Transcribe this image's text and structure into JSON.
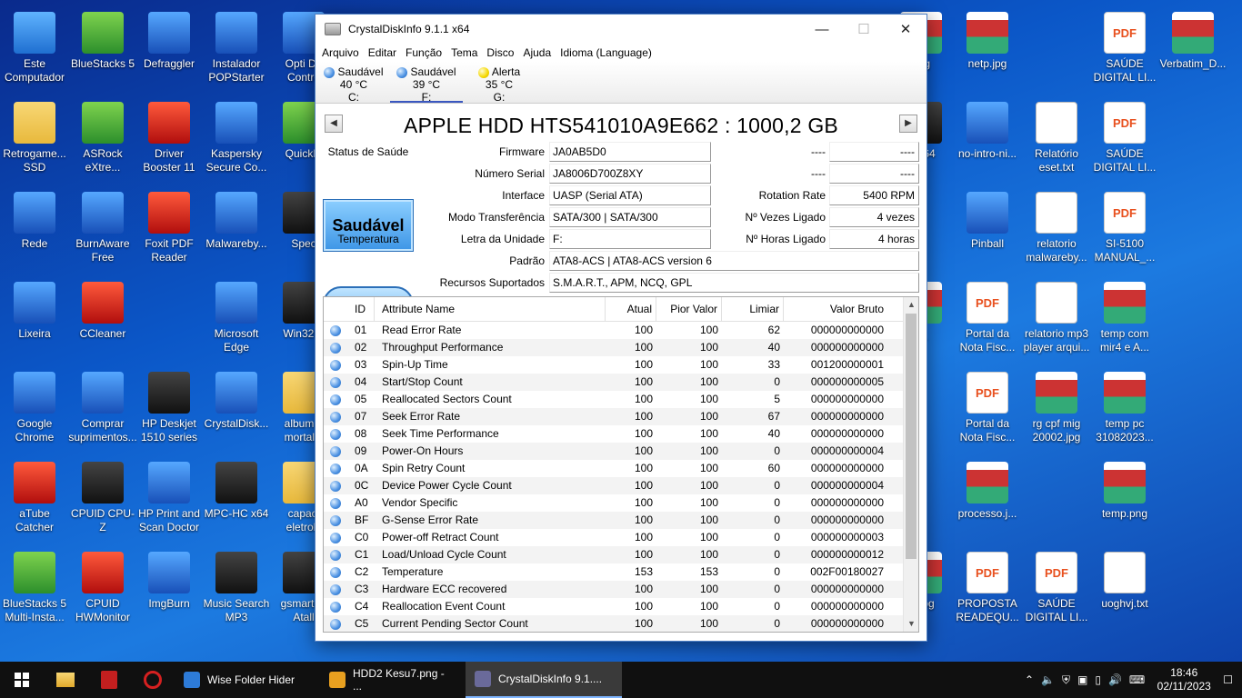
{
  "desktop_icons": [
    {
      "label": "Este Computador",
      "type": "pc"
    },
    {
      "label": "BlueStacks 5",
      "type": "green"
    },
    {
      "label": "Defraggler",
      "type": "blue"
    },
    {
      "label": "Instalador POPStarter",
      "type": "blue"
    },
    {
      "label": "Opti Dri Contro",
      "type": "blue"
    },
    {
      "label": "Retrogame... SSD",
      "type": "folder"
    },
    {
      "label": "ASRock eXtre...",
      "type": "green"
    },
    {
      "label": "Driver Booster 11",
      "type": "red"
    },
    {
      "label": "Kaspersky Secure Co...",
      "type": "blue"
    },
    {
      "label": "QuickM",
      "type": "green"
    },
    {
      "label": "Rede",
      "type": "blue"
    },
    {
      "label": "BurnAware Free",
      "type": "blue"
    },
    {
      "label": "Foxit PDF Reader",
      "type": "red"
    },
    {
      "label": "Malwareby...",
      "type": "blue"
    },
    {
      "label": "Spec",
      "type": "app"
    },
    {
      "label": "Lixeira",
      "type": "blue"
    },
    {
      "label": "CCleaner",
      "type": "red"
    },
    {
      "label": "Microsoft Edge",
      "type": "blue"
    },
    {
      "label": "Win32Di",
      "type": "app"
    },
    {
      "label": "Google Chrome",
      "type": "round"
    },
    {
      "label": "Comprar suprimentos...",
      "type": "blue"
    },
    {
      "label": "HP Deskjet 1510 series",
      "type": "app"
    },
    {
      "label": "CrystalDisk...",
      "type": "blue"
    },
    {
      "label": "album a mortal k",
      "type": "folder"
    },
    {
      "label": "aTube Catcher",
      "type": "red"
    },
    {
      "label": "CPUID CPU-Z",
      "type": "app"
    },
    {
      "label": "HP Print and Scan Doctor",
      "type": "blue"
    },
    {
      "label": "MPC-HC x64",
      "type": "app"
    },
    {
      "label": "capaci eletrolit",
      "type": "folder"
    },
    {
      "label": "BlueStacks 5 Multi-Insta...",
      "type": "green"
    },
    {
      "label": "CPUID HWMonitor",
      "type": "red"
    },
    {
      "label": "ImgBurn",
      "type": "round"
    },
    {
      "label": "Music Search MP3",
      "type": "app"
    },
    {
      "label": "gsmarto - Atall",
      "type": "app"
    },
    {
      "label": "peg",
      "type": "img"
    },
    {
      "label": "netp.jpg",
      "type": "img"
    },
    {
      "label": "SAÚDE DIGITAL LI...",
      "type": "pdf"
    },
    {
      "label": "Verbatim_D...",
      "type": "img"
    },
    {
      "label": "C x64",
      "type": "app"
    },
    {
      "label": "no-intro-ni...",
      "type": "blue"
    },
    {
      "label": "Relatório eset.txt",
      "type": "txt"
    },
    {
      "label": "SAÚDE DIGITAL LI...",
      "type": "pdf"
    },
    {
      "label": "Pinball",
      "type": "round"
    },
    {
      "label": "relatorio malwareby...",
      "type": "txt"
    },
    {
      "label": "SI-5100 MANUAL_...",
      "type": "pdf"
    },
    {
      "label": "h_",
      "type": "img"
    },
    {
      "label": "Portal da Nota Fisc...",
      "type": "pdf"
    },
    {
      "label": "relatorio mp3 player arqui...",
      "type": "txt"
    },
    {
      "label": "temp com mir4 e A...",
      "type": "img"
    },
    {
      "label": "Portal da Nota Fisc...",
      "type": "pdf"
    },
    {
      "label": "rg cpf mig 20002.jpg",
      "type": "img"
    },
    {
      "label": "temp pc 31082023...",
      "type": "img"
    },
    {
      "label": "processo.j...",
      "type": "img"
    },
    {
      "label": "temp.png",
      "type": "img"
    },
    {
      "label": "o .jpg",
      "type": "img"
    },
    {
      "label": "PROPOSTA READEQU...",
      "type": "pdf"
    },
    {
      "label": "SAÚDE DIGITAL LI...",
      "type": "pdf"
    },
    {
      "label": "uoghvj.txt",
      "type": "txt"
    }
  ],
  "window": {
    "title": "CrystalDiskInfo 9.1.1 x64",
    "menu": [
      "Arquivo",
      "Editar",
      "Função",
      "Tema",
      "Disco",
      "Ajuda",
      "Idioma (Language)"
    ],
    "drives": [
      {
        "status": "Saudável",
        "temp": "40 °C",
        "letter": "C:",
        "color": "blue"
      },
      {
        "status": "Saudável",
        "temp": "39 °C",
        "letter": "F:",
        "color": "blue"
      },
      {
        "status": "Alerta",
        "temp": "35 °C",
        "letter": "G:",
        "color": "yellow"
      }
    ],
    "model": "APPLE HDD HTS541010A9E662 : 1000,2 GB",
    "nav_prev": "◀",
    "nav_next": "▶",
    "health_label": "Status de Saúde",
    "health_value": "Saudável",
    "temp_label": "Temperatura",
    "temp_value": "39 °C",
    "fields": {
      "firmware_label": "Firmware",
      "firmware": "JA0AB5D0",
      "serial_label": "Número Serial",
      "serial": "JA8006D700Z8XY",
      "interface_label": "Interface",
      "interface": "UASP (Serial ATA)",
      "transfer_label": "Modo Transferência",
      "transfer": "SATA/300 | SATA/300",
      "letter_label": "Letra da Unidade",
      "letter": "F:",
      "standard_label": "Padrão",
      "standard": "ATA8-ACS | ATA8-ACS version 6",
      "features_label": "Recursos Suportados",
      "features": "S.M.A.R.T., APM, NCQ, GPL",
      "r1_label": "----",
      "r1": "----",
      "r2_label": "----",
      "r2": "----",
      "rotation_label": "Rotation Rate",
      "rotation": "5400 RPM",
      "poweron_count_label": "Nº Vezes Ligado",
      "poweron_count": "4 vezes",
      "poweron_hours_label": "Nº Horas Ligado",
      "poweron_hours": "4 horas"
    },
    "table_headers": {
      "id": "ID",
      "name": "Attribute Name",
      "atual": "Atual",
      "pior": "Pior Valor",
      "lim": "Limiar",
      "raw": "Valor Bruto"
    },
    "attributes": [
      {
        "id": "01",
        "name": "Read Error Rate",
        "atual": "100",
        "pior": "100",
        "lim": "62",
        "raw": "000000000000"
      },
      {
        "id": "02",
        "name": "Throughput Performance",
        "atual": "100",
        "pior": "100",
        "lim": "40",
        "raw": "000000000000"
      },
      {
        "id": "03",
        "name": "Spin-Up Time",
        "atual": "100",
        "pior": "100",
        "lim": "33",
        "raw": "001200000001"
      },
      {
        "id": "04",
        "name": "Start/Stop Count",
        "atual": "100",
        "pior": "100",
        "lim": "0",
        "raw": "000000000005"
      },
      {
        "id": "05",
        "name": "Reallocated Sectors Count",
        "atual": "100",
        "pior": "100",
        "lim": "5",
        "raw": "000000000000"
      },
      {
        "id": "07",
        "name": "Seek Error Rate",
        "atual": "100",
        "pior": "100",
        "lim": "67",
        "raw": "000000000000"
      },
      {
        "id": "08",
        "name": "Seek Time Performance",
        "atual": "100",
        "pior": "100",
        "lim": "40",
        "raw": "000000000000"
      },
      {
        "id": "09",
        "name": "Power-On Hours",
        "atual": "100",
        "pior": "100",
        "lim": "0",
        "raw": "000000000004"
      },
      {
        "id": "0A",
        "name": "Spin Retry Count",
        "atual": "100",
        "pior": "100",
        "lim": "60",
        "raw": "000000000000"
      },
      {
        "id": "0C",
        "name": "Device Power Cycle Count",
        "atual": "100",
        "pior": "100",
        "lim": "0",
        "raw": "000000000004"
      },
      {
        "id": "A0",
        "name": "Vendor Specific",
        "atual": "100",
        "pior": "100",
        "lim": "0",
        "raw": "000000000000"
      },
      {
        "id": "BF",
        "name": "G-Sense Error Rate",
        "atual": "100",
        "pior": "100",
        "lim": "0",
        "raw": "000000000000"
      },
      {
        "id": "C0",
        "name": "Power-off Retract Count",
        "atual": "100",
        "pior": "100",
        "lim": "0",
        "raw": "000000000003"
      },
      {
        "id": "C1",
        "name": "Load/Unload Cycle Count",
        "atual": "100",
        "pior": "100",
        "lim": "0",
        "raw": "000000000012"
      },
      {
        "id": "C2",
        "name": "Temperature",
        "atual": "153",
        "pior": "153",
        "lim": "0",
        "raw": "002F00180027"
      },
      {
        "id": "C3",
        "name": "Hardware ECC recovered",
        "atual": "100",
        "pior": "100",
        "lim": "0",
        "raw": "000000000000"
      },
      {
        "id": "C4",
        "name": "Reallocation Event Count",
        "atual": "100",
        "pior": "100",
        "lim": "0",
        "raw": "000000000000"
      },
      {
        "id": "C5",
        "name": "Current Pending Sector Count",
        "atual": "100",
        "pior": "100",
        "lim": "0",
        "raw": "000000000000"
      }
    ]
  },
  "taskbar": {
    "apps": [
      {
        "label": "Wise Folder Hider",
        "active": false
      },
      {
        "label": "HDD2 Kesu7.png - ...",
        "active": false
      },
      {
        "label": "CrystalDiskInfo 9.1....",
        "active": true
      }
    ],
    "time": "18:46",
    "date": "02/11/2023"
  },
  "colors": {
    "accent": "#3a57c0",
    "health_blue": "#3d95e6",
    "taskbar": "#101010"
  }
}
